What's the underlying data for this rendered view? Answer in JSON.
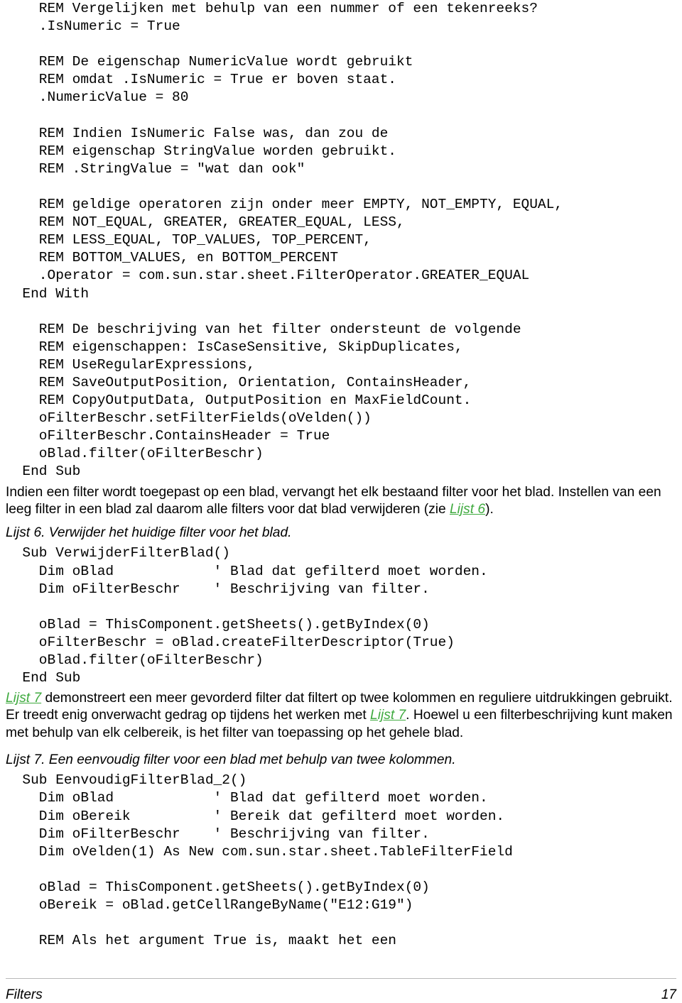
{
  "document": {
    "page_number": "17",
    "footer_title": "Filters",
    "link_color": "#3faa3f",
    "text_color": "#000000",
    "background": "#ffffff"
  },
  "blocks": [
    {
      "type": "code",
      "name": "code-block-filter-descriptor-continued",
      "lines": [
        "    REM Vergelijken met behulp van een nummer of een tekenreeks?",
        "    .IsNumeric = True",
        "",
        "    REM De eigenschap NumericValue wordt gebruikt",
        "    REM omdat .IsNumeric = True er boven staat.",
        "    .NumericValue = 80",
        "",
        "    REM Indien IsNumeric False was, dan zou de",
        "    REM eigenschap StringValue worden gebruikt.",
        "    REM .StringValue = \"wat dan ook\"",
        "",
        "    REM geldige operatoren zijn onder meer EMPTY, NOT_EMPTY, EQUAL,",
        "    REM NOT_EQUAL, GREATER, GREATER_EQUAL, LESS,",
        "    REM LESS_EQUAL, TOP_VALUES, TOP_PERCENT,",
        "    REM BOTTOM_VALUES, en BOTTOM_PERCENT",
        "    .Operator = com.sun.star.sheet.FilterOperator.GREATER_EQUAL",
        "  End With",
        "",
        "    REM De beschrijving van het filter ondersteunt de volgende",
        "    REM eigenschappen: IsCaseSensitive, SkipDuplicates,",
        "    REM UseRegularExpressions,",
        "    REM SaveOutputPosition, Orientation, ContainsHeader,",
        "    REM CopyOutputData, OutputPosition en MaxFieldCount.",
        "    oFilterBeschr.setFilterFields(oVelden())",
        "    oFilterBeschr.ContainsHeader = True",
        "    oBlad.filter(oFilterBeschr)",
        "  End Sub"
      ]
    },
    {
      "type": "paragraph",
      "name": "paragraph-filter-replaces",
      "runs": [
        {
          "text": "Indien een filter wordt toegepast op een blad, vervangt het elk bestaand filter voor het blad. Instellen van een leeg filter in een blad zal daarom alle filters voor dat blad verwijderen (zie ",
          "style": "normal"
        },
        {
          "text": "Lijst 6",
          "style": "xref"
        },
        {
          "text": ").",
          "style": "normal"
        }
      ]
    },
    {
      "type": "caption",
      "name": "caption-lijst-6",
      "text": "Lijst 6. Verwijder het huidige filter voor het blad."
    },
    {
      "type": "code",
      "name": "code-block-verwijder-filter-blad",
      "lines": [
        "  Sub VerwijderFilterBlad()",
        "    Dim oBlad            ' Blad dat gefilterd moet worden.",
        "    Dim oFilterBeschr    ' Beschrijving van filter.",
        "",
        "    oBlad = ThisComponent.getSheets().getByIndex(0)",
        "    oFilterBeschr = oBlad.createFilterDescriptor(True)",
        "    oBlad.filter(oFilterBeschr)",
        "  End Sub"
      ]
    },
    {
      "type": "paragraph",
      "name": "paragraph-lijst-7-intro",
      "runs": [
        {
          "text": "Lijst 7",
          "style": "xref"
        },
        {
          "text": " demonstreert een meer gevorderd filter dat filtert op twee kolommen en reguliere uitdrukkingen gebruikt. Er treedt enig onverwacht gedrag op tijdens het werken met ",
          "style": "normal"
        },
        {
          "text": "Lijst 7",
          "style": "xref"
        },
        {
          "text": ". Hoewel u een filterbeschrijving kunt maken met behulp van elk celbereik, is het filter van toepassing op het gehele  blad.",
          "style": "normal"
        }
      ]
    },
    {
      "type": "caption",
      "name": "caption-lijst-7",
      "text": "Lijst 7. Een eenvoudig filter voor een blad met behulp van twee kolommen."
    },
    {
      "type": "code",
      "name": "code-block-eenvoudig-filter-blad-2",
      "lines": [
        "  Sub EenvoudigFilterBlad_2()",
        "    Dim oBlad            ' Blad dat gefilterd moet worden.",
        "    Dim oBereik          ' Bereik dat gefilterd moet worden.",
        "    Dim oFilterBeschr    ' Beschrijving van filter.",
        "    Dim oVelden(1) As New com.sun.star.sheet.TableFilterField",
        "",
        "    oBlad = ThisComponent.getSheets().getByIndex(0)",
        "    oBereik = oBlad.getCellRangeByName(\"E12:G19\")",
        "",
        "    REM Als het argument True is, maakt het een"
      ]
    }
  ]
}
